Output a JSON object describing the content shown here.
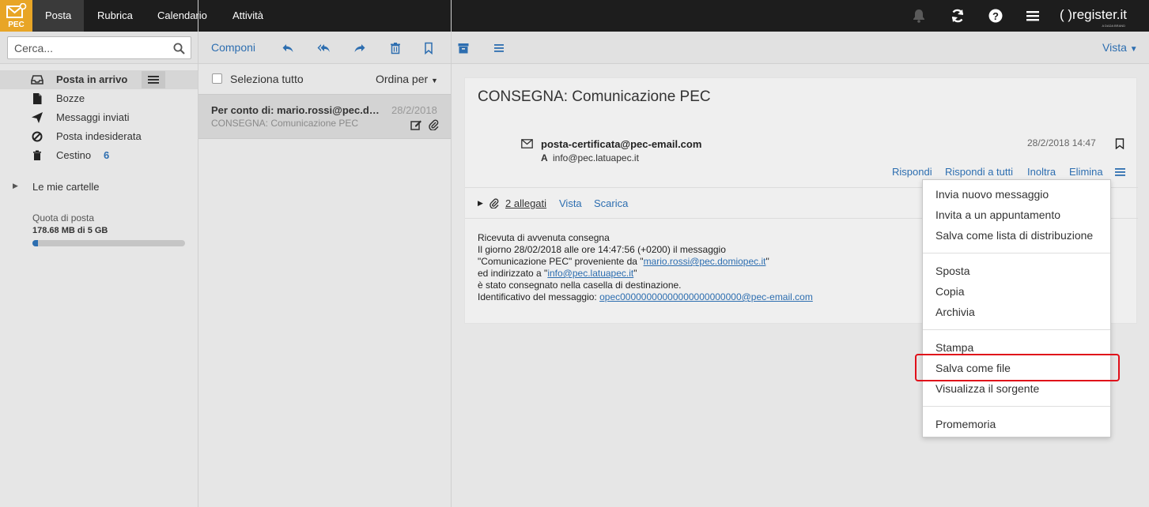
{
  "app": {
    "logo_text": "PEC",
    "brand": "( )register.it",
    "brand_sub": "A DADA BRAND"
  },
  "nav": {
    "tabs": [
      "Posta",
      "Rubrica",
      "Calendario",
      "Attività"
    ]
  },
  "search": {
    "placeholder": "Cerca..."
  },
  "toolbar": {
    "compose": "Componi",
    "view": "Vista"
  },
  "sidebar": {
    "folders": [
      {
        "label": "Posta in arrivo",
        "icon": "inbox-icon"
      },
      {
        "label": "Bozze",
        "icon": "draft-icon"
      },
      {
        "label": "Messaggi inviati",
        "icon": "send-icon"
      },
      {
        "label": "Posta indesiderata",
        "icon": "spam-icon"
      },
      {
        "label": "Cestino",
        "icon": "trash-icon",
        "count": "6"
      }
    ],
    "my_folders": "Le mie cartelle",
    "quota_label": "Quota di posta",
    "quota_value": "178.68 MB di 5 GB",
    "quota_fraction": 0.035
  },
  "list": {
    "select_all": "Seleziona tutto",
    "sort": "Ordina per",
    "message": {
      "from": "Per conto di: mario.rossi@pec.domiopec.it",
      "date": "28/2/2018",
      "subject": "CONSEGNA: Comunicazione PEC"
    }
  },
  "reading": {
    "title": "CONSEGNA: Comunicazione PEC",
    "from": "posta-certificata@pec-email.com",
    "to_label": "A",
    "to": "info@pec.latuapec.it",
    "date": "28/2/2018 14:47",
    "actions": [
      "Rispondi",
      "Rispondi a tutti",
      "Inoltra",
      "Elimina"
    ],
    "attachments": "2 allegati",
    "att_view": "Vista",
    "att_download": "Scarica",
    "body": {
      "l1": "Ricevuta di avvenuta consegna",
      "l2": "Il giorno 28/02/2018 alle ore 14:47:56 (+0200) il messaggio",
      "l3a": "\"Comunicazione PEC\" proveniente da \"",
      "l3link": "mario.rossi@pec.domiopec.it",
      "l3b": "\"",
      "l4a": "ed indirizzato a \"",
      "l4link": "info@pec.latuapec.it",
      "l4b": "\"",
      "l5": "è stato consegnato nella casella di destinazione.",
      "l6a": "Identificativo del messaggio: ",
      "l6link": "opec00000000000000000000000@pec-email.com"
    }
  },
  "menu": {
    "items": [
      "Invia nuovo messaggio",
      "Invita a un appuntamento",
      "Salva come lista di distribuzione",
      "Sposta",
      "Copia",
      "Archivia",
      "Stampa",
      "Salva come file",
      "Visualizza il sorgente",
      "Promemoria"
    ]
  },
  "colors": {
    "accent": "#2d6eb0",
    "logo": "#e8a526",
    "topbar": "#1d1d1d",
    "highlight": "#e0101a"
  }
}
